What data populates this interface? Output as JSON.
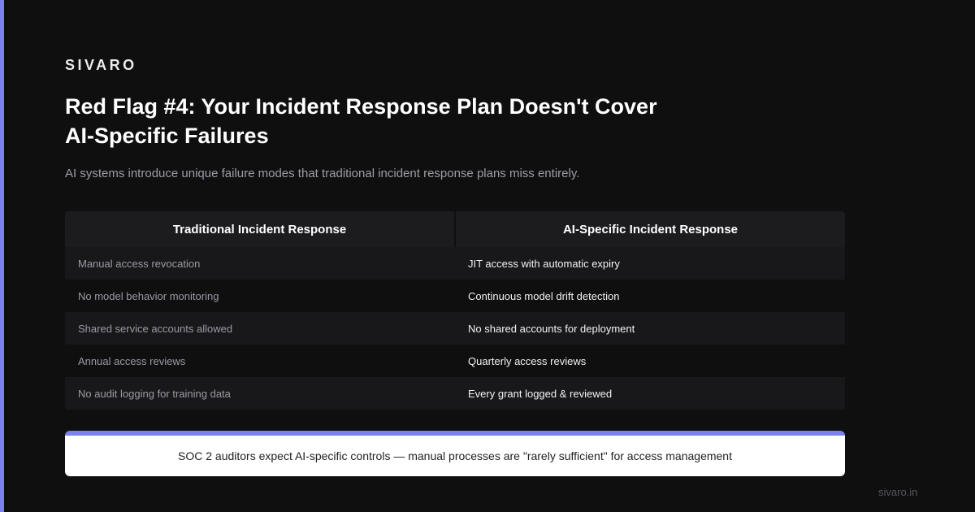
{
  "brand": "SIVARO",
  "title": "Red Flag #4: Your Incident Response Plan Doesn't Cover AI-Specific Failures",
  "subtitle": "AI systems introduce unique failure modes that traditional incident response plans miss entirely.",
  "table": {
    "headers": [
      "Traditional Incident Response",
      "AI-Specific Incident Response"
    ],
    "rows": [
      [
        "Manual access revocation",
        "JIT access with automatic expiry"
      ],
      [
        "No model behavior monitoring",
        "Continuous model drift detection"
      ],
      [
        "Shared service accounts allowed",
        "No shared accounts for deployment"
      ],
      [
        "Annual access reviews",
        "Quarterly access reviews"
      ],
      [
        "No audit logging for training data",
        "Every grant logged & reviewed"
      ]
    ]
  },
  "callout": "SOC 2 auditors expect AI-specific controls — manual processes are \"rarely sufficient\" for access management",
  "footer": "sivaro.in",
  "colors": {
    "accent": "#7b82f0",
    "background": "#0f0f10"
  }
}
